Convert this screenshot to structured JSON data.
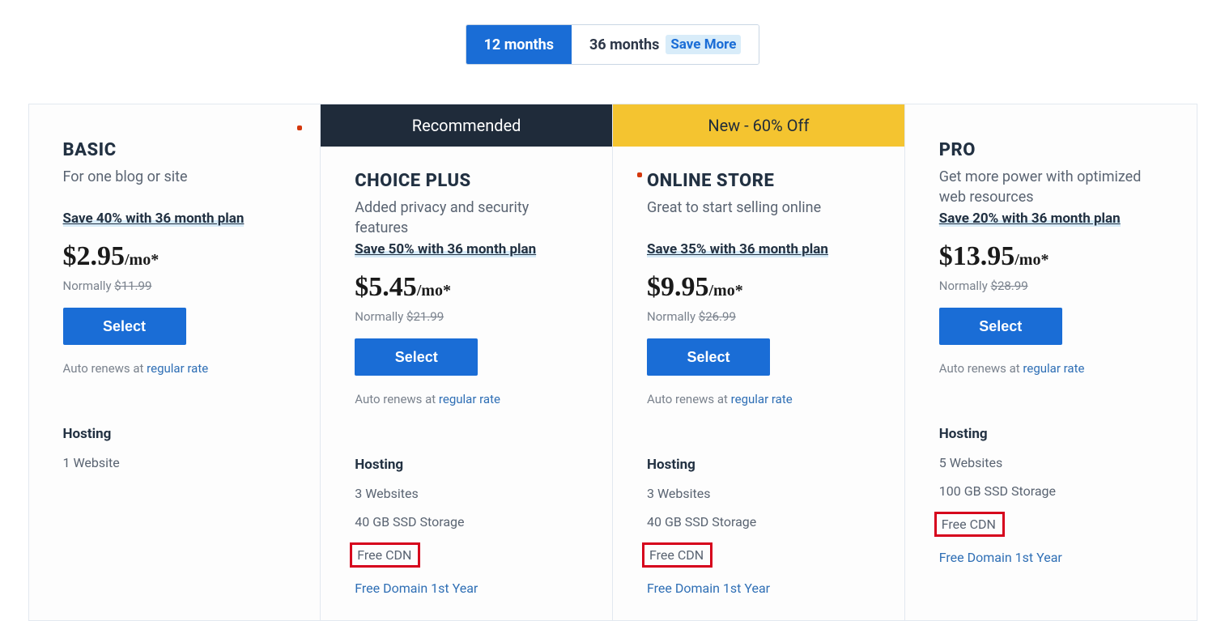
{
  "toggle": {
    "option_a": "12 months",
    "option_b": "36 months",
    "save_more": "Save More"
  },
  "banners": {
    "recommended": "Recommended",
    "new": "New - 60% Off"
  },
  "common": {
    "select_label": "Select",
    "renew_prefix": "Auto renews at ",
    "renew_link": "regular rate",
    "hosting_heading": "Hosting",
    "normally_prefix": "Normally "
  },
  "plans": [
    {
      "name": "BASIC",
      "desc": "For one blog or site",
      "save": "Save 40% with 36 month plan",
      "price": "$2.95",
      "unit": "/mo*",
      "normally": "$11.99",
      "features": [
        {
          "text": "1 Website",
          "link": false,
          "box": false
        }
      ]
    },
    {
      "name": "CHOICE PLUS",
      "desc": "Added privacy and security features",
      "save": "Save 50% with 36 month plan",
      "price": "$5.45",
      "unit": "/mo*",
      "normally": "$21.99",
      "features": [
        {
          "text": "3 Websites",
          "link": false,
          "box": false
        },
        {
          "text": "40 GB SSD Storage",
          "link": false,
          "box": false
        },
        {
          "text": "Free CDN",
          "link": false,
          "box": true
        },
        {
          "text": "Free Domain 1st Year",
          "link": true,
          "box": false
        }
      ]
    },
    {
      "name": "ONLINE STORE",
      "desc": "Great to start selling online",
      "save": "Save 35% with 36 month plan",
      "price": "$9.95",
      "unit": "/mo*",
      "normally": "$26.99",
      "features": [
        {
          "text": "3 Websites",
          "link": false,
          "box": false
        },
        {
          "text": "40 GB SSD Storage",
          "link": false,
          "box": false
        },
        {
          "text": "Free CDN",
          "link": false,
          "box": true
        },
        {
          "text": "Free Domain 1st Year",
          "link": true,
          "box": false
        }
      ]
    },
    {
      "name": "PRO",
      "desc": "Get more power with optimized web resources",
      "save": "Save 20% with 36 month plan",
      "price": "$13.95",
      "unit": "/mo*",
      "normally": "$28.99",
      "features": [
        {
          "text": "5 Websites",
          "link": false,
          "box": false
        },
        {
          "text": "100 GB SSD Storage",
          "link": false,
          "box": false
        },
        {
          "text": "Free CDN",
          "link": false,
          "box": true
        },
        {
          "text": "Free Domain 1st Year",
          "link": true,
          "box": false
        }
      ]
    }
  ]
}
